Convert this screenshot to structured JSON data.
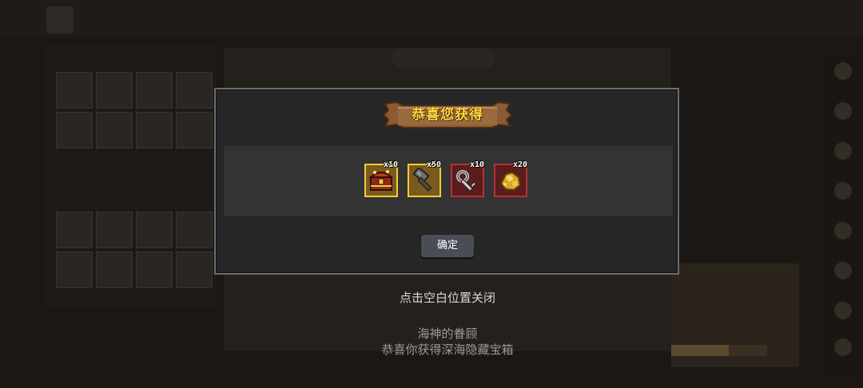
{
  "modal": {
    "title": "恭喜您获得",
    "confirm_label": "确定",
    "rewards": [
      {
        "icon": "treasure-chest-icon",
        "quantity": "x10",
        "rarity": "gold"
      },
      {
        "icon": "hammer-icon",
        "quantity": "x50",
        "rarity": "gold"
      },
      {
        "icon": "silver-key-icon",
        "quantity": "x10",
        "rarity": "red"
      },
      {
        "icon": "gold-ore-icon",
        "quantity": "x20",
        "rarity": "red"
      }
    ]
  },
  "overlay": {
    "close_hint": "点击空白位置关闭",
    "caption_line1": "海神的眷顾",
    "caption_line2": "恭喜你获得深海隐藏宝箱"
  },
  "colors": {
    "gold_frame": "#f2cc38",
    "red_frame": "#b8303a",
    "title_text": "#ffd940",
    "modal_bg": "#262626"
  }
}
